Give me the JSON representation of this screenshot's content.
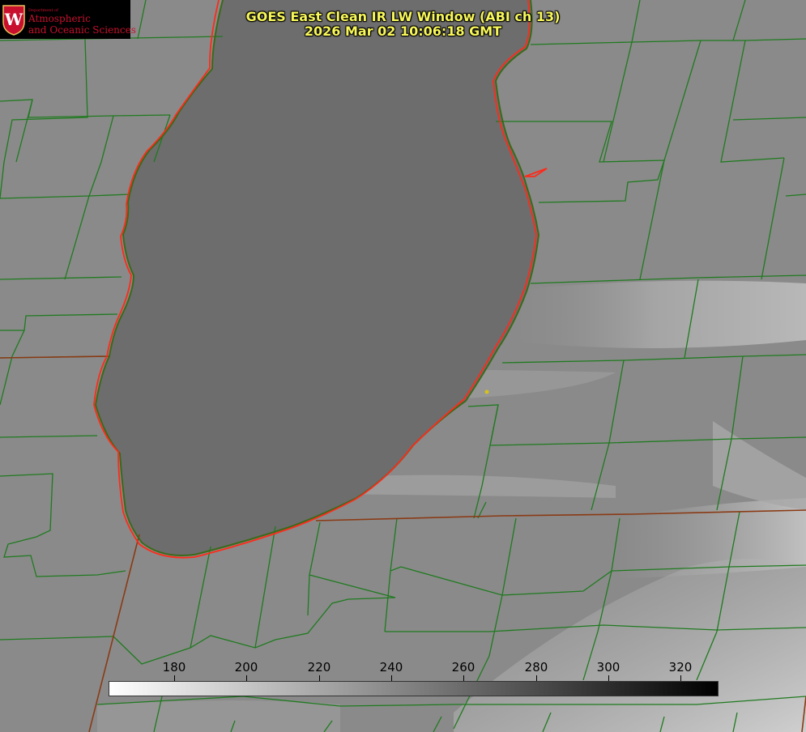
{
  "logo": {
    "department": "Department of",
    "line1": "Atmospheric",
    "line2": "and Oceanic Sciences",
    "crest_letter": "W",
    "crest_color": "#c8102e"
  },
  "title": {
    "line1": "GOES East Clean IR LW Window (ABI ch 13)",
    "line2": "2026 Mar 02 10:06:18 GMT"
  },
  "colorbar": {
    "ticks": [
      "180",
      "200",
      "220",
      "240",
      "260",
      "280",
      "300",
      "320"
    ],
    "gradient_start": "#ffffff",
    "gradient_end": "#000000"
  },
  "colors": {
    "county_lines": "#1f7a1f",
    "coastline": "#ff2a1a",
    "state_line": "#8a3a14",
    "title_text": "#f7f75a",
    "marker": "#d4c21a"
  }
}
